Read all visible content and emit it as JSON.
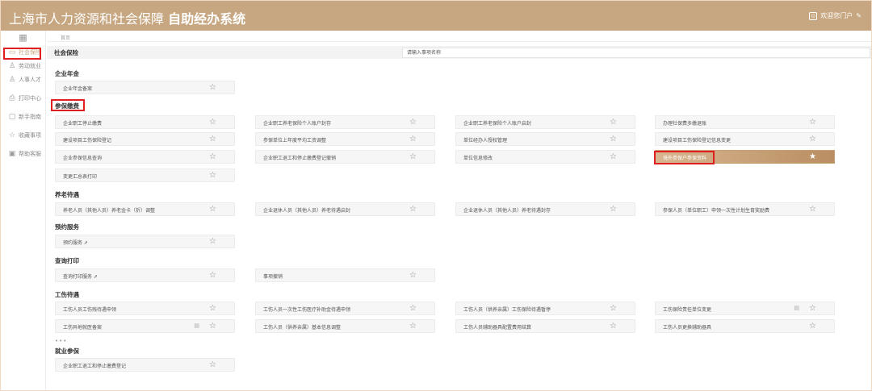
{
  "header": {
    "title": "上海市人力资源和社会保障",
    "subtitle": "自助经办系统",
    "user_label": "欢迎您门户"
  },
  "sidebar": {
    "top_icon": "grid-icon",
    "items": [
      {
        "label": "社会保险",
        "icon": "folder-icon",
        "active": true
      },
      {
        "label": "劳动就业",
        "icon": "person-icon"
      },
      {
        "label": "人事人才",
        "icon": "person-group-icon"
      },
      {
        "label": "打印中心",
        "icon": "printer-icon"
      },
      {
        "label": "新手指南",
        "icon": "guide-icon"
      },
      {
        "label": "收藏事项",
        "icon": "star-icon"
      },
      {
        "label": "帮助客服",
        "icon": "help-icon"
      }
    ]
  },
  "breadcrumb": "首页",
  "topbar": {
    "label": "社会保险",
    "search_placeholder": "请输入事项名称"
  },
  "sections": [
    {
      "title": "企业年金",
      "items": [
        {
          "label": "企业年金备案"
        }
      ]
    },
    {
      "title": "参保缴费",
      "items": [
        {
          "label": "企业职工停止缴费"
        },
        {
          "label": "企业职工养老保险个人账户封存"
        },
        {
          "label": "企业职工养老保险个人账户启封"
        },
        {
          "label": "办理社保费多缴退账"
        },
        {
          "label": "建设项目工伤保险登记"
        },
        {
          "label": "参保单位上年度平均工资调整"
        },
        {
          "label": "单位经办人授权管理"
        },
        {
          "label": "建设项目工伤保险登记信息变更"
        },
        {
          "label": "企业参保信息查询"
        },
        {
          "label": "企业职工退工和停止缴费登记撤销"
        },
        {
          "label": "单位信息修改"
        },
        {
          "label": "境外参保户参保资料",
          "highlight": true
        },
        {
          "label": "变更汇总表打印"
        }
      ]
    },
    {
      "title": "养老待遇",
      "items": [
        {
          "label": "养老人员（其他人员）养老金卡（折）调整"
        },
        {
          "label": "企业退休人员（其他人员）养老待遇启封"
        },
        {
          "label": "企业退休人员（其他人员）养老待遇封存"
        },
        {
          "label": "参保人员（单位职工）申领一次性计划生育奖励费"
        }
      ]
    },
    {
      "title": "预约服务",
      "items": [
        {
          "label": "预约服务 ⇗"
        }
      ]
    },
    {
      "title": "查询打印",
      "items": [
        {
          "label": "查询打印服务 ⇗"
        },
        {
          "label": "事项撤销"
        }
      ]
    },
    {
      "title": "工伤待遇",
      "items": [
        {
          "label": "工伤人员工伤残待遇申领"
        },
        {
          "label": "工伤人员一次性工伤医疗补助金待遇申领"
        },
        {
          "label": "工伤人员（供养亲属）工伤保险待遇暂停"
        },
        {
          "label": "工伤保险责任单位变更"
        },
        {
          "label": "工伤异地就医备案"
        },
        {
          "label": "工伤人员（供养亲属）基本信息调整"
        },
        {
          "label": "工伤人员辅助器具配置费用结算"
        },
        {
          "label": "工伤人员更换辅助器具"
        }
      ]
    },
    {
      "title": "就业参保",
      "items": [
        {
          "label": "企业职工退工和停止缴费登记"
        }
      ]
    }
  ],
  "more_label": "•••",
  "colors": {
    "brand": "#c7a781",
    "annotation": "#e02020"
  }
}
